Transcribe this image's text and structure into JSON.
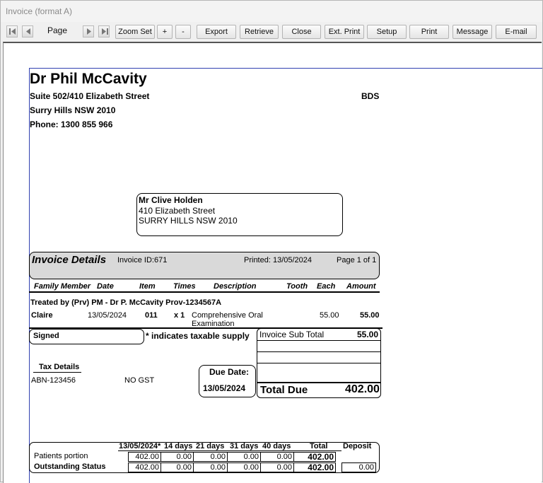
{
  "window": {
    "title": "Invoice (format A)"
  },
  "toolbar": {
    "page_label": "Page",
    "buttons": {
      "zoom_set": "Zoom Set",
      "plus": "+",
      "minus": "-",
      "export": "Export",
      "retrieve": "Retrieve",
      "close": "Close",
      "ext_print": "Ext. Print",
      "setup": "Setup",
      "print": "Print",
      "message": "Message",
      "email": "E-mail"
    }
  },
  "practice": {
    "name": "Dr Phil McCavity",
    "address1": "Suite 502/410 Elizabeth Street",
    "address2": "Surry Hills NSW 2010",
    "phone": "Phone: 1300 855 966",
    "qualification": "BDS"
  },
  "patient": {
    "name": "Mr Clive  Holden",
    "address1": "410 Elizabeth Street",
    "address2": "SURRY HILLS NSW 2010"
  },
  "invoice_header": {
    "title": "Invoice Details",
    "invoice_id": "Invoice ID:671",
    "printed": "Printed: 13/05/2024",
    "page": "Page 1 of 1"
  },
  "columns": {
    "family_member": "Family Member",
    "date": "Date",
    "item": "Item",
    "times": "Times",
    "description": "Description",
    "tooth": "Tooth",
    "each": "Each",
    "amount": "Amount"
  },
  "treated_by": "Treated by (Prv) PM - Dr P. McCavity Prov-1234567A",
  "line_items": [
    {
      "family_member": "Claire",
      "date": "13/05/2024",
      "item": "011",
      "times": "x 1",
      "description_line1": "Comprehensive Oral",
      "description_line2": "Examination",
      "each": "55.00",
      "amount": "55.00"
    }
  ],
  "signed_label": "Signed",
  "taxable_note": "* indicates taxable supply",
  "totals": {
    "sub_total_label": "Invoice Sub Total",
    "sub_total": "55.00",
    "total_due_label": "Total Due",
    "total_due": "402.00"
  },
  "tax": {
    "label": "Tax Details",
    "abn": "ABN-123456",
    "gst": "NO GST"
  },
  "due": {
    "label": "Due Date:",
    "date": "13/05/2024"
  },
  "aging": {
    "headers": [
      "13/05/2024*",
      "14 days",
      "21 days",
      "31 days",
      "40 days",
      "Total",
      "Deposit"
    ],
    "rows": [
      {
        "label": "Patients portion",
        "values": [
          "402.00",
          "0.00",
          "0.00",
          "0.00",
          "0.00",
          "402.00"
        ]
      },
      {
        "label": "Outstanding Status",
        "values": [
          "402.00",
          "0.00",
          "0.00",
          "0.00",
          "0.00",
          "402.00"
        ],
        "deposit": "0.00"
      }
    ]
  }
}
